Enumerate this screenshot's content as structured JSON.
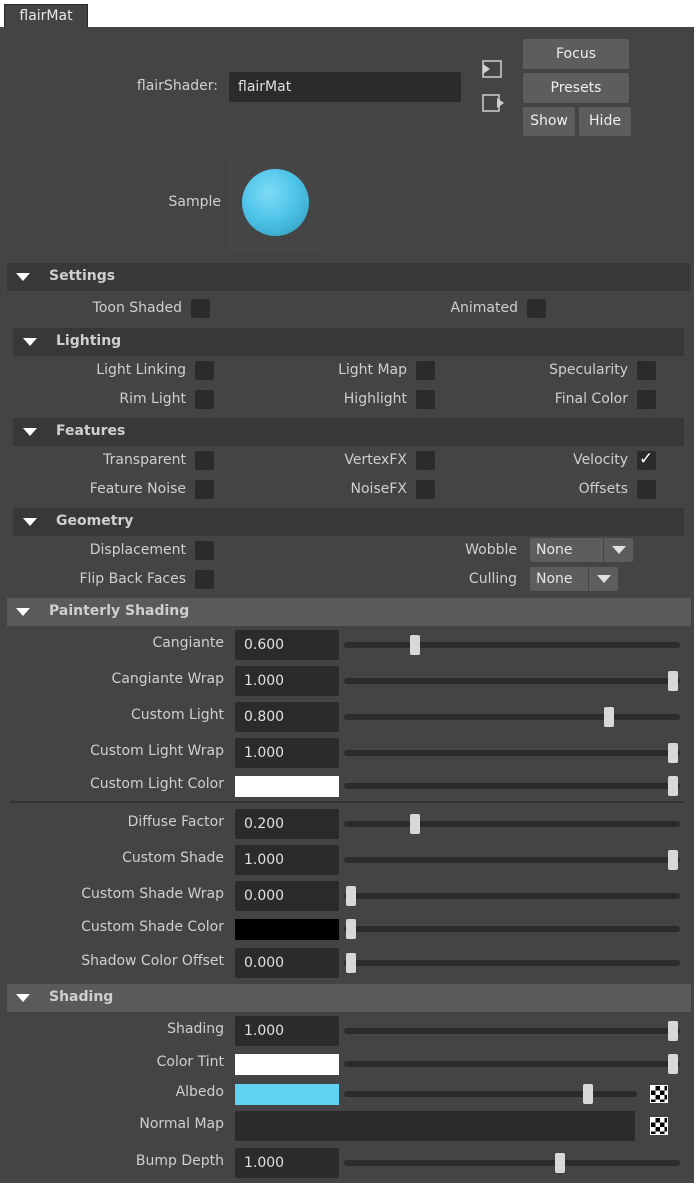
{
  "tab": {
    "label": "flairMat"
  },
  "header": {
    "shader_label": "flairShader:",
    "shader_value": "flairMat",
    "focus_label": "Focus",
    "presets_label": "Presets",
    "show_label": "Show",
    "hide_label": "Hide",
    "sample_label": "Sample",
    "sample_color": "#4fc5ea"
  },
  "settings": {
    "title": "Settings",
    "toon_shaded": {
      "label": "Toon Shaded",
      "checked": false
    },
    "animated": {
      "label": "Animated",
      "checked": false
    }
  },
  "lighting": {
    "title": "Lighting",
    "items": [
      {
        "label": "Light Linking",
        "checked": false
      },
      {
        "label": "Light Map",
        "checked": false
      },
      {
        "label": "Specularity",
        "checked": false
      },
      {
        "label": "Rim Light",
        "checked": false
      },
      {
        "label": "Highlight",
        "checked": false
      },
      {
        "label": "Final Color",
        "checked": false
      }
    ]
  },
  "features": {
    "title": "Features",
    "items": [
      {
        "label": "Transparent",
        "checked": false
      },
      {
        "label": "VertexFX",
        "checked": false
      },
      {
        "label": "Velocity",
        "checked": true
      },
      {
        "label": "Feature Noise",
        "checked": false
      },
      {
        "label": "NoiseFX",
        "checked": false
      },
      {
        "label": "Offsets",
        "checked": false
      }
    ]
  },
  "geometry": {
    "title": "Geometry",
    "displacement": {
      "label": "Displacement",
      "checked": false
    },
    "flip_back_faces": {
      "label": "Flip Back Faces",
      "checked": false
    },
    "wobble": {
      "label": "Wobble",
      "value": "None"
    },
    "culling": {
      "label": "Culling",
      "value": "None"
    }
  },
  "painterly": {
    "title": "Painterly Shading",
    "rows": [
      {
        "label": "Cangiante",
        "value": "0.600",
        "slider": 0.2
      },
      {
        "label": "Cangiante Wrap",
        "value": "1.000",
        "slider": 1.0
      },
      {
        "label": "Custom Light",
        "value": "0.800",
        "slider": 0.8
      },
      {
        "label": "Custom Light Wrap",
        "value": "1.000",
        "slider": 1.0
      },
      {
        "label": "Custom Light Color",
        "color": "#ffffff",
        "slider": 1.0
      },
      {
        "label": "Diffuse Factor",
        "value": "0.200",
        "slider": 0.2
      },
      {
        "label": "Custom Shade",
        "value": "1.000",
        "slider": 1.0
      },
      {
        "label": "Custom Shade Wrap",
        "value": "0.000",
        "slider": 0.0
      },
      {
        "label": "Custom Shade Color",
        "color": "#000000",
        "slider": 0.0
      },
      {
        "label": "Shadow Color Offset",
        "value": "0.000",
        "slider": 0.0
      }
    ]
  },
  "shading": {
    "title": "Shading",
    "rows": [
      {
        "label": "Shading",
        "value": "1.000",
        "slider": 1.0
      },
      {
        "label": "Color Tint",
        "color": "#ffffff",
        "slider": 1.0
      },
      {
        "label": "Albedo",
        "color": "#5fd3ef",
        "slider": 0.85
      },
      {
        "label": "Normal Map",
        "value": ""
      },
      {
        "label": "Bump Depth",
        "value": "1.000",
        "slider": 0.65
      }
    ]
  }
}
